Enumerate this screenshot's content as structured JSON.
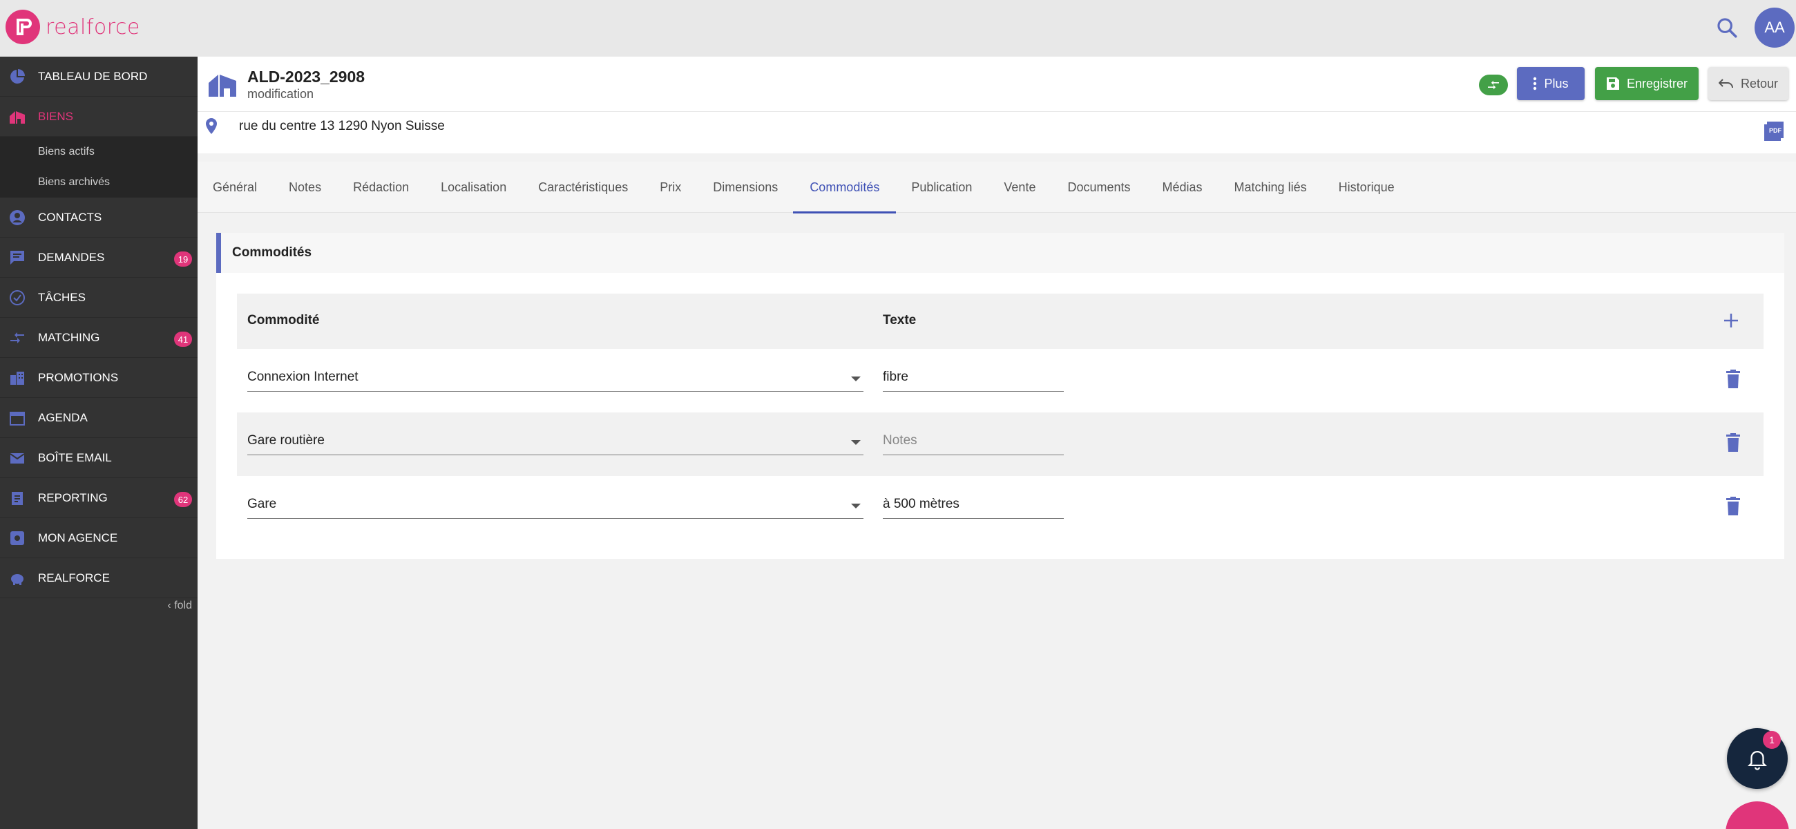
{
  "brand": {
    "name": "realforce",
    "color": "#e0357a",
    "accent": "#5c6bc0"
  },
  "topbar": {
    "avatar_initials": "AA",
    "search_icon": "search-icon"
  },
  "sidebar": {
    "items": [
      {
        "label": "TABLEAU DE BORD",
        "icon": "dashboard-icon",
        "badge": ""
      },
      {
        "label": "BIENS",
        "icon": "home-icon",
        "badge": "",
        "active": true
      },
      {
        "label": "CONTACTS",
        "icon": "person-icon",
        "badge": ""
      },
      {
        "label": "DEMANDES",
        "icon": "chat-icon",
        "badge": "19"
      },
      {
        "label": "TÂCHES",
        "icon": "check-circle-icon",
        "badge": ""
      },
      {
        "label": "MATCHING",
        "icon": "compare-arrows-icon",
        "badge": "41"
      },
      {
        "label": "PROMOTIONS",
        "icon": "buildings-icon",
        "badge": ""
      },
      {
        "label": "AGENDA",
        "icon": "calendar-icon",
        "badge": ""
      },
      {
        "label": "BOÎTE EMAIL",
        "icon": "mail-icon",
        "badge": ""
      },
      {
        "label": "REPORTING",
        "icon": "clipboard-icon",
        "badge": "62"
      },
      {
        "label": "MON AGENCE",
        "icon": "agency-icon",
        "badge": ""
      },
      {
        "label": "REALFORCE",
        "icon": "piggy-icon",
        "badge": ""
      }
    ],
    "sub_items": [
      "Biens actifs",
      "Biens archivés"
    ],
    "fold_label": "fold"
  },
  "header": {
    "title": "ALD-2023_2908",
    "subtitle": "modification",
    "plus_label": "Plus",
    "save_label": "Enregistrer",
    "back_label": "Retour",
    "address": "rue du centre 13 1290 Nyon Suisse"
  },
  "tabs": [
    "Général",
    "Notes",
    "Rédaction",
    "Localisation",
    "Caractéristiques",
    "Prix",
    "Dimensions",
    "Commodités",
    "Publication",
    "Vente",
    "Documents",
    "Médias",
    "Matching liés",
    "Historique"
  ],
  "active_tab": "Commodités",
  "panel": {
    "title": "Commodités",
    "col_commodite": "Commodité",
    "col_texte": "Texte",
    "rows": [
      {
        "commodite": "Connexion Internet",
        "texte": "fibre"
      },
      {
        "commodite": "Gare routière",
        "texte": ""
      },
      {
        "commodite": "Gare",
        "texte": "à 500 mètres"
      }
    ],
    "texte_placeholder": "Notes"
  },
  "notifications": {
    "count": "1"
  }
}
